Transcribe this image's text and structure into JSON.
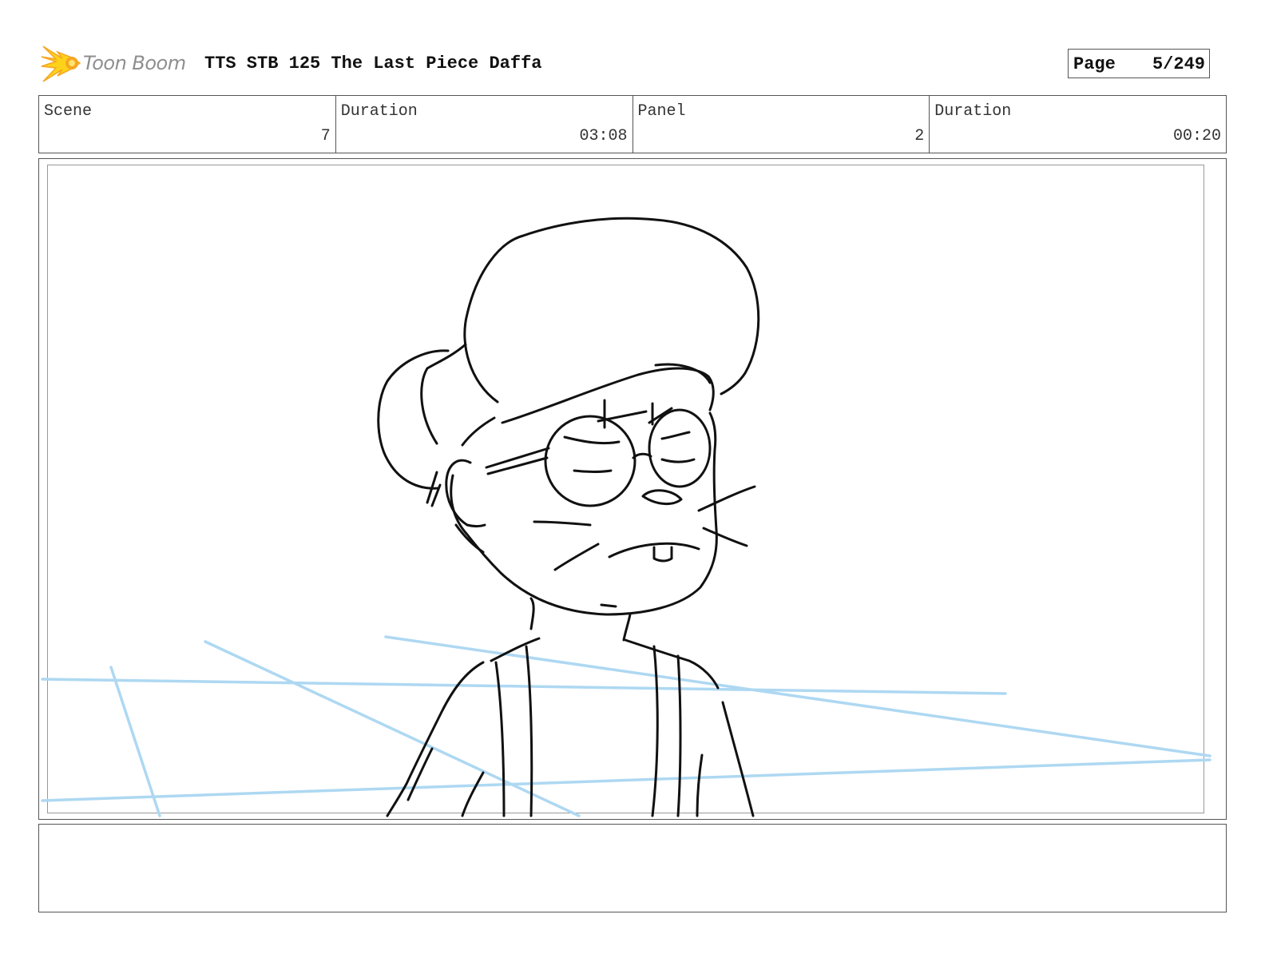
{
  "header": {
    "logo_text": "Toon Boom",
    "title": "TTS STB 125 The Last Piece Daffa",
    "page_label": "Page",
    "page_value": "5/249"
  },
  "info": {
    "scene_label": "Scene",
    "scene_value": "7",
    "scene_duration_label": "Duration",
    "scene_duration_value": "03:08",
    "panel_label": "Panel",
    "panel_value": "2",
    "panel_duration_label": "Duration",
    "panel_duration_value": "00:20"
  },
  "notes": {
    "text": ""
  },
  "colors": {
    "logo_orange": "#f5a623",
    "logo_yellow": "#ffd21a",
    "sketch_ink": "#111111",
    "guide_blue": "#aed8f2"
  }
}
